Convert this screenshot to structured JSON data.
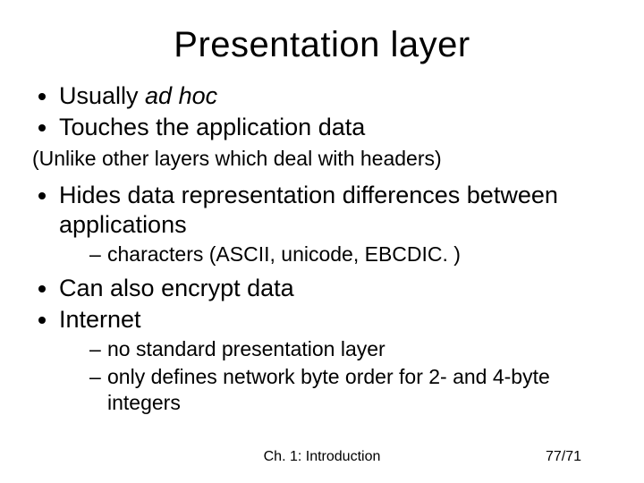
{
  "title": "Presentation layer",
  "bullets": {
    "b1_pre": "Usually ",
    "b1_it": "ad hoc",
    "b2": "Touches the application data",
    "para": "(Unlike other layers which deal with headers)",
    "b3": "Hides data representation differences between applications",
    "b3_sub1": "characters (ASCII, unicode, EBCDIC. )",
    "b4": "Can also encrypt data",
    "b5": "Internet",
    "b5_sub1": "no standard presentation layer",
    "b5_sub2": "only defines network byte order for 2- and 4-byte integers"
  },
  "footer": {
    "chapter": "Ch. 1: Introduction",
    "page": "77/71"
  }
}
